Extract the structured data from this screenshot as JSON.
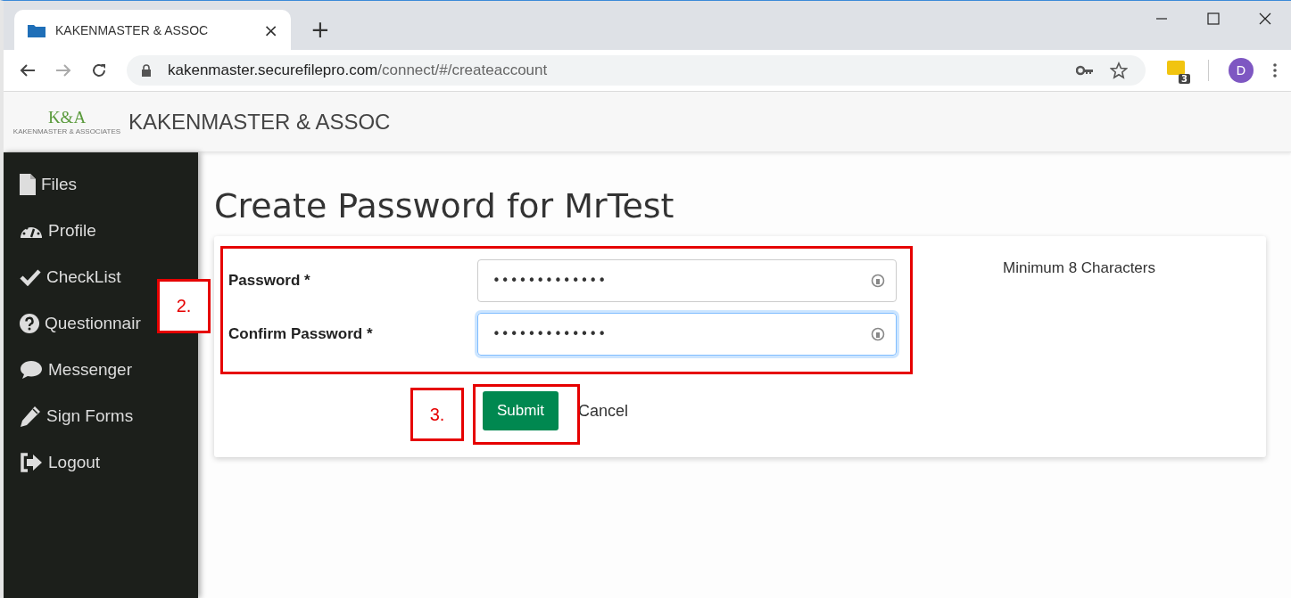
{
  "browser": {
    "tab": {
      "title": "KAKENMASTER & ASSOC",
      "close": "×",
      "selected": true
    },
    "new_tab": "+",
    "address": {
      "host": "kakenmaster.securefilepro.com",
      "path": "/connect/#/createaccount"
    },
    "extension_badge": "3",
    "profile_initial": "D"
  },
  "header": {
    "logo": {
      "mark": "K&A",
      "subtitle": "KAKENMASTER & ASSOCIATES"
    },
    "title": "KAKENMASTER & ASSOC"
  },
  "sidebar": {
    "items": [
      {
        "label": "Files",
        "kind": "file"
      },
      {
        "label": "Profile",
        "kind": "gauge"
      },
      {
        "label": "CheckList",
        "kind": "check"
      },
      {
        "label": "Questionnair",
        "kind": "question"
      },
      {
        "label": "Messenger",
        "kind": "chat"
      },
      {
        "label": "Sign Forms",
        "kind": "pencil"
      },
      {
        "label": "Logout",
        "kind": "logout"
      }
    ]
  },
  "page": {
    "title": "Create Password for MrTest",
    "fields": [
      {
        "label": "Password *",
        "value": "•••••••••••••",
        "focused": false
      },
      {
        "label": "Confirm Password *",
        "value": "•••••••••••••",
        "focused": true
      }
    ],
    "hint": "Minimum 8 Characters",
    "submit": "Submit",
    "cancel": "Cancel"
  },
  "annotations": [
    {
      "label": "2."
    },
    {
      "label": "3."
    }
  ]
}
